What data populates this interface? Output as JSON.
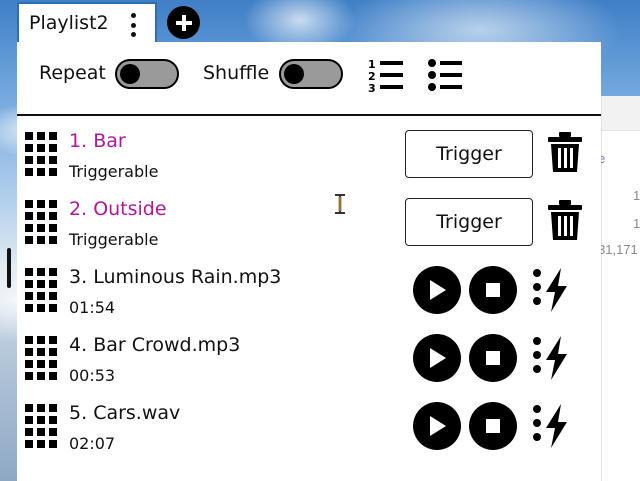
{
  "tab": {
    "label": "Playlist2"
  },
  "toolbar": {
    "repeat_label": "Repeat",
    "shuffle_label": "Shuffle",
    "repeat_on": false,
    "shuffle_on": false
  },
  "items": [
    {
      "number": "1.",
      "title": "Bar",
      "kind": "trigger",
      "subtitle": "Triggerable",
      "button": "Trigger"
    },
    {
      "number": "2.",
      "title": "Outside",
      "kind": "trigger",
      "subtitle": "Triggerable",
      "button": "Trigger"
    },
    {
      "number": "3.",
      "title": "Luminous Rain.mp3",
      "kind": "audio",
      "subtitle": "01:54"
    },
    {
      "number": "4.",
      "title": "Bar Crowd.mp3",
      "kind": "audio",
      "subtitle": "00:53"
    },
    {
      "number": "5.",
      "title": "Cars.wav",
      "kind": "audio",
      "subtitle": "02:07"
    }
  ],
  "background_window": {
    "texts": [
      "e",
      "1",
      "1",
      "31,171"
    ]
  },
  "colors": {
    "trigger_title": "#b0169c",
    "tab_border": "#2d6fb0"
  }
}
